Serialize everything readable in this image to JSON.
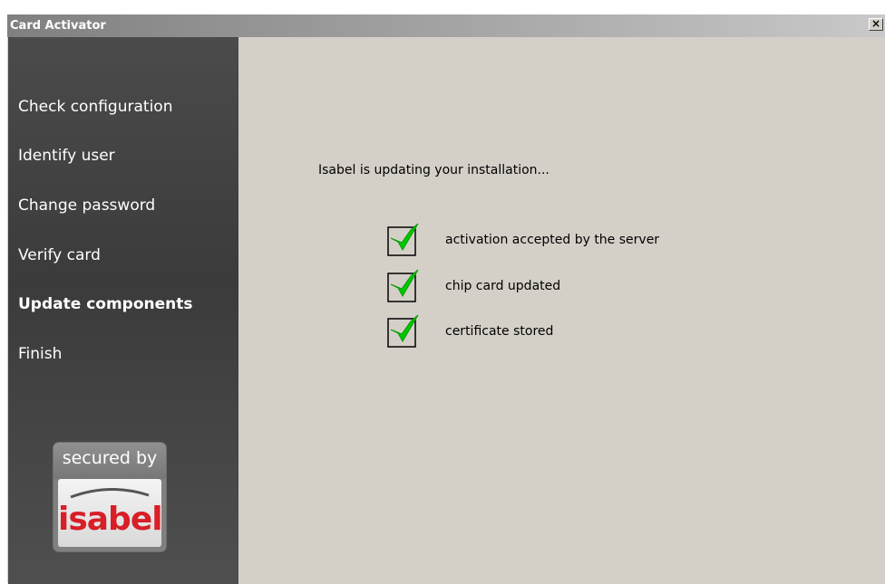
{
  "window": {
    "title": "Card Activator",
    "close_label": "×"
  },
  "sidebar": {
    "items": [
      {
        "label": "Check configuration",
        "active": false
      },
      {
        "label": "Identify user",
        "active": false
      },
      {
        "label": "Change password",
        "active": false
      },
      {
        "label": "Verify card",
        "active": false
      },
      {
        "label": "Update components",
        "active": true
      },
      {
        "label": "Finish",
        "active": false
      }
    ],
    "logo": {
      "top_text": "secured by",
      "brand": "isabel"
    }
  },
  "main": {
    "status": "Isabel is updating your installation...",
    "tasks": [
      {
        "label": "activation accepted by the server",
        "done": true,
        "icon": "checkmark-icon"
      },
      {
        "label": "chip card updated",
        "done": true,
        "icon": "checkmark-icon"
      },
      {
        "label": "certificate stored",
        "done": true,
        "icon": "checkmark-icon"
      }
    ]
  },
  "colors": {
    "check_green": "#00c800",
    "brand_red": "#d81e27",
    "sidebar_bg": "#3f3f3f"
  }
}
